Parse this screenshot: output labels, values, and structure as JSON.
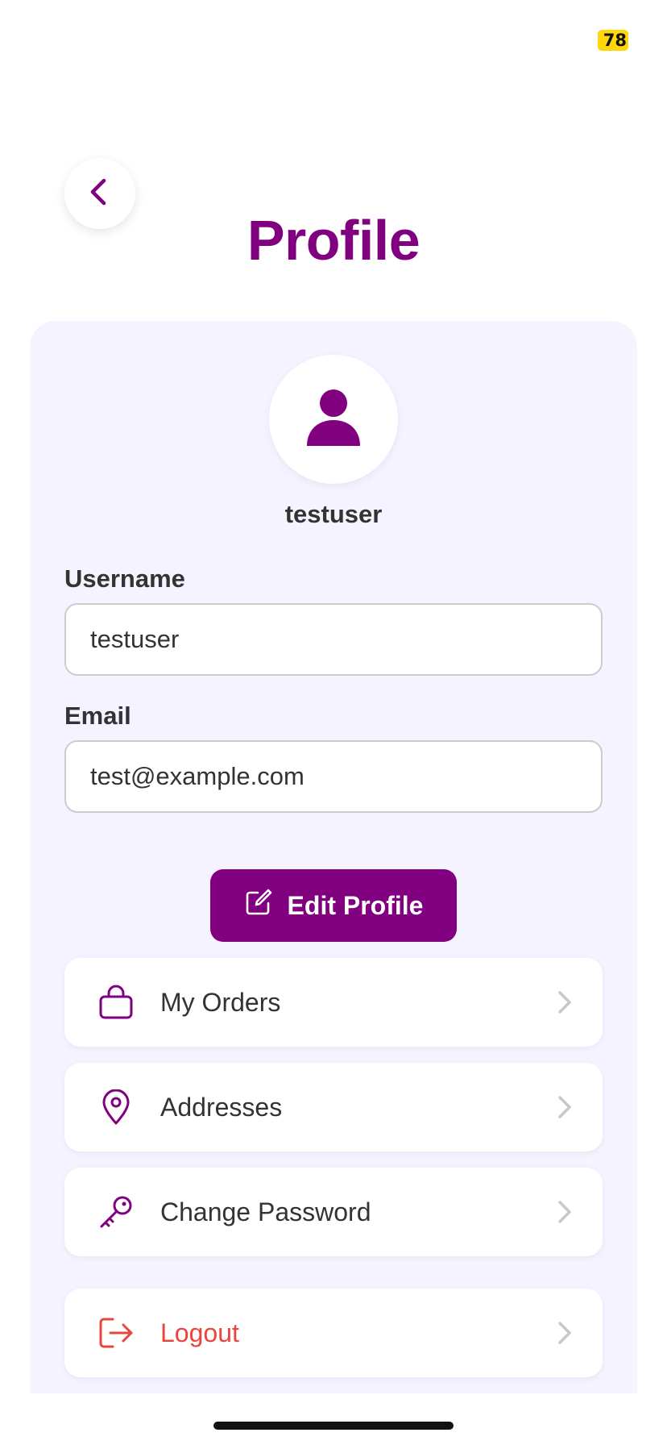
{
  "status": {
    "badge": "78"
  },
  "header": {
    "title": "Profile"
  },
  "profile": {
    "display_name": "testuser",
    "username_label": "Username",
    "username_value": "testuser",
    "email_label": "Email",
    "email_value": "test@example.com",
    "edit_button_label": "Edit Profile"
  },
  "menu": {
    "items": [
      {
        "label": "My Orders",
        "icon": "shopping-bag-icon"
      },
      {
        "label": "Addresses",
        "icon": "map-pin-icon"
      },
      {
        "label": "Change Password",
        "icon": "key-icon"
      },
      {
        "label": "Logout",
        "icon": "logout-icon"
      }
    ]
  },
  "colors": {
    "accent": "#800080",
    "card_background": "#f5f3ff",
    "danger": "#e8453c",
    "chevron": "#c7c7cc"
  }
}
